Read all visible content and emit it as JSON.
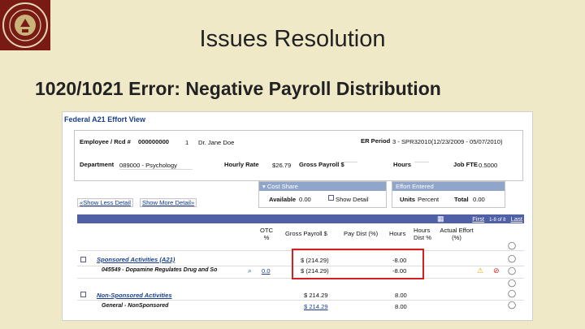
{
  "slide": {
    "title": "Issues Resolution",
    "subtitle": "1020/1021 Error: Negative Payroll Distribution"
  },
  "app": {
    "title": "Federal A21 Effort View",
    "employee": {
      "label": "Employee / Rcd #",
      "id": "000000000",
      "rcd": "1",
      "name": "Dr. Jane Doe"
    },
    "er_period": {
      "label": "ER Period",
      "value": "3 - SPR32010(12/23/2009 - 05/07/2010)"
    },
    "department": {
      "label": "Department",
      "value": "089000 - Psychology"
    },
    "hourly_rate": {
      "label": "Hourly Rate",
      "value": "$26.79"
    },
    "gross_payroll": {
      "label": "Gross Payroll $",
      "value": ""
    },
    "hours": {
      "label": "Hours",
      "value": ""
    },
    "job_fte": {
      "label": "Job FTE",
      "value": "0.5000"
    },
    "cost_share": {
      "header": "Cost Share",
      "available_label": "Available",
      "available_value": "0.00",
      "show_detail": "Show Detail"
    },
    "effort_entered": {
      "header": "Effort Entered",
      "units_label": "Units",
      "units_value": "Percent",
      "total_label": "Total",
      "total_value": "0.00"
    },
    "show_less": "Show Less Detail",
    "show_more": "Show More Detail",
    "grid_nav": {
      "first": "First",
      "range": "1-8 of 8",
      "last": "Last"
    },
    "columns": {
      "otc": "OTC %",
      "gross": "Gross Payroll $",
      "paydist": "Pay Dist (%)",
      "hours": "Hours",
      "hours_dist": "Hours Dist %",
      "actual_effort": "Actual Effort (%)"
    },
    "rows": [
      {
        "kind": "group",
        "label": "Sponsored Activities (A21)",
        "gross": "$ (214.29)",
        "hours": "-8.00"
      },
      {
        "kind": "detail",
        "label": "045549 - Dopamine Regulates Drug and So",
        "otc": "0.0",
        "gross": "$ (214.29)",
        "hours": "-8.00"
      },
      {
        "kind": "group",
        "label": "Non-Sponsored Activities",
        "gross": "$ 214.29",
        "hours": "8.00"
      },
      {
        "kind": "detail",
        "label": "General - NonSponsored",
        "gross": "$ 214.29",
        "hours": "8.00"
      }
    ]
  },
  "colors": {
    "background": "#efe9c8",
    "link": "#1b3f8b",
    "grid_header": "#5060a6",
    "highlight": "#d42020",
    "seal": "#7a1a14"
  },
  "icons": [
    "seal-logo",
    "comment-icon",
    "warning-icon",
    "no-entry-icon",
    "calendar-icon",
    "lookup-icon"
  ]
}
